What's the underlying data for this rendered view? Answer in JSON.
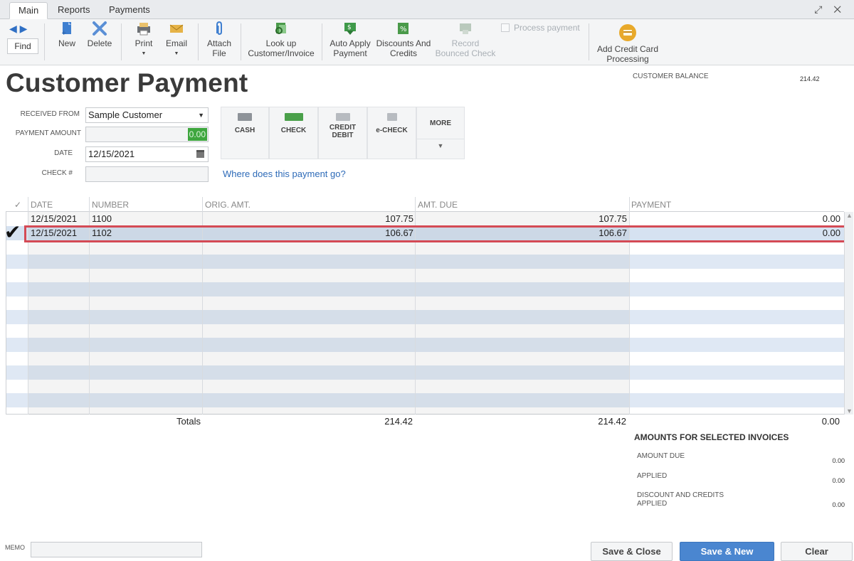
{
  "tabs": [
    "Main",
    "Reports",
    "Payments"
  ],
  "toolbar": {
    "find": "Find",
    "new": "New",
    "delete": "Delete",
    "print": "Print",
    "email": "Email",
    "attach_line1": "Attach",
    "attach_line2": "File",
    "lookup_line1": "Look up",
    "lookup_line2": "Customer/Invoice",
    "autoapply_line1": "Auto Apply",
    "autoapply_line2": "Payment",
    "discounts_line1": "Discounts And",
    "discounts_line2": "Credits",
    "record_line1": "Record",
    "record_line2": "Bounced Check",
    "process_payment": "Process payment",
    "addcc_line1": "Add Credit Card",
    "addcc_line2": "Processing"
  },
  "header": {
    "title": "Customer Payment",
    "customer_balance_label": "CUSTOMER BALANCE",
    "customer_balance_value": "214.42"
  },
  "form": {
    "received_from_label": "RECEIVED FROM",
    "received_from_value": "Sample Customer",
    "payment_amount_label": "PAYMENT AMOUNT",
    "payment_amount_value": "0.00",
    "date_label": "DATE",
    "date_value": "12/15/2021",
    "check_label": "CHECK #",
    "check_value": ""
  },
  "payment_methods": {
    "cash": "CASH",
    "check": "CHECK",
    "credit_line1": "CREDIT",
    "credit_line2": "DEBIT",
    "echeck": "e-CHECK",
    "more": "MORE"
  },
  "where_link": "Where does this payment go?",
  "grid": {
    "columns": {
      "check": "✓",
      "date": "DATE",
      "number": "NUMBER",
      "orig_amt": "ORIG. AMT.",
      "amt_due": "AMT. DUE",
      "payment": "PAYMENT"
    },
    "rows": [
      {
        "date": "12/15/2021",
        "number": "1100",
        "orig_amt": "107.75",
        "amt_due": "107.75",
        "payment": "0.00"
      },
      {
        "date": "12/15/2021",
        "number": "1102",
        "orig_amt": "106.67",
        "amt_due": "106.67",
        "payment": "0.00"
      }
    ],
    "totals_label": "Totals",
    "totals_orig": "214.42",
    "totals_due": "214.42",
    "totals_payment": "0.00"
  },
  "summary": {
    "title": "AMOUNTS FOR SELECTED INVOICES",
    "amount_due_label": "AMOUNT DUE",
    "amount_due_value": "0.00",
    "applied_label": "APPLIED",
    "applied_value": "0.00",
    "discount_line1": "DISCOUNT AND CREDITS",
    "discount_line2": "APPLIED",
    "discount_value": "0.00"
  },
  "footer": {
    "memo_label": "MEMO",
    "save_close": "Save & Close",
    "save_new": "Save & New",
    "clear": "Clear"
  },
  "colors": {
    "accent_blue": "#4a86d0",
    "highlight_red": "#d44a55",
    "selected_row": "#d6e2f1",
    "stripe": "#dfe8f4",
    "amount_highlight": "#3ea63e"
  }
}
